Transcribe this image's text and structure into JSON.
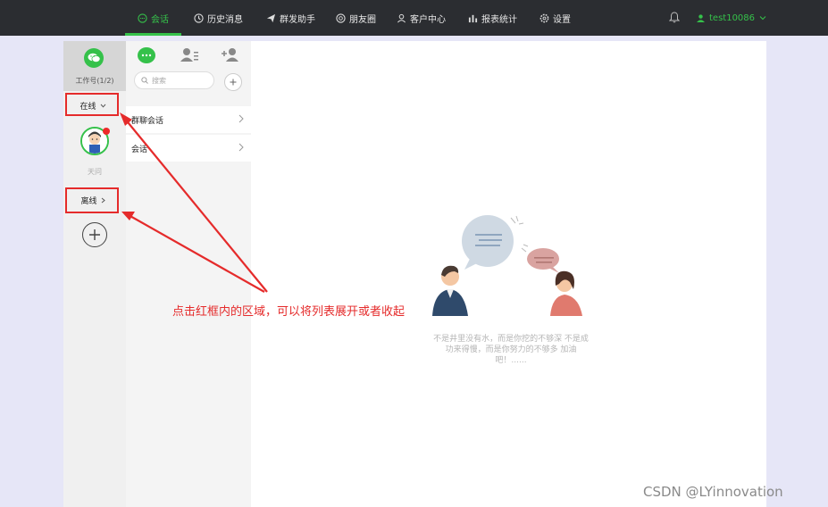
{
  "nav": {
    "items": [
      {
        "label": "会话",
        "icon": "chat-icon",
        "active": true
      },
      {
        "label": "历史消息",
        "icon": "clock-icon"
      },
      {
        "label": "群发助手",
        "icon": "send-icon"
      },
      {
        "label": "朋友圈",
        "icon": "moments-icon"
      },
      {
        "label": "客户中心",
        "icon": "person-icon"
      },
      {
        "label": "报表统计",
        "icon": "bar-chart-icon"
      },
      {
        "label": "设置",
        "icon": "gear-icon"
      }
    ],
    "bell_icon": "bell-icon",
    "username": "test10086",
    "accent": "#35c14a"
  },
  "accounts": {
    "title": "工作号(1/2)",
    "online_label": "在线",
    "offline_label": "离线",
    "avatar_name": "天问",
    "add_icon": "plus-circle-icon"
  },
  "list": {
    "search_placeholder": "搜索",
    "rows": [
      {
        "label": "群聊会话"
      },
      {
        "label": "会话"
      }
    ]
  },
  "empty": {
    "text": "不是井里没有水，而是你挖的不够深 不是成功来得慢，而是你努力的不够多 加油吧！......"
  },
  "annotation": {
    "text": "点击红框内的区域，可以将列表展开或者收起",
    "color": "#e52b2b"
  },
  "watermark": "CSDN @LYinnovation"
}
